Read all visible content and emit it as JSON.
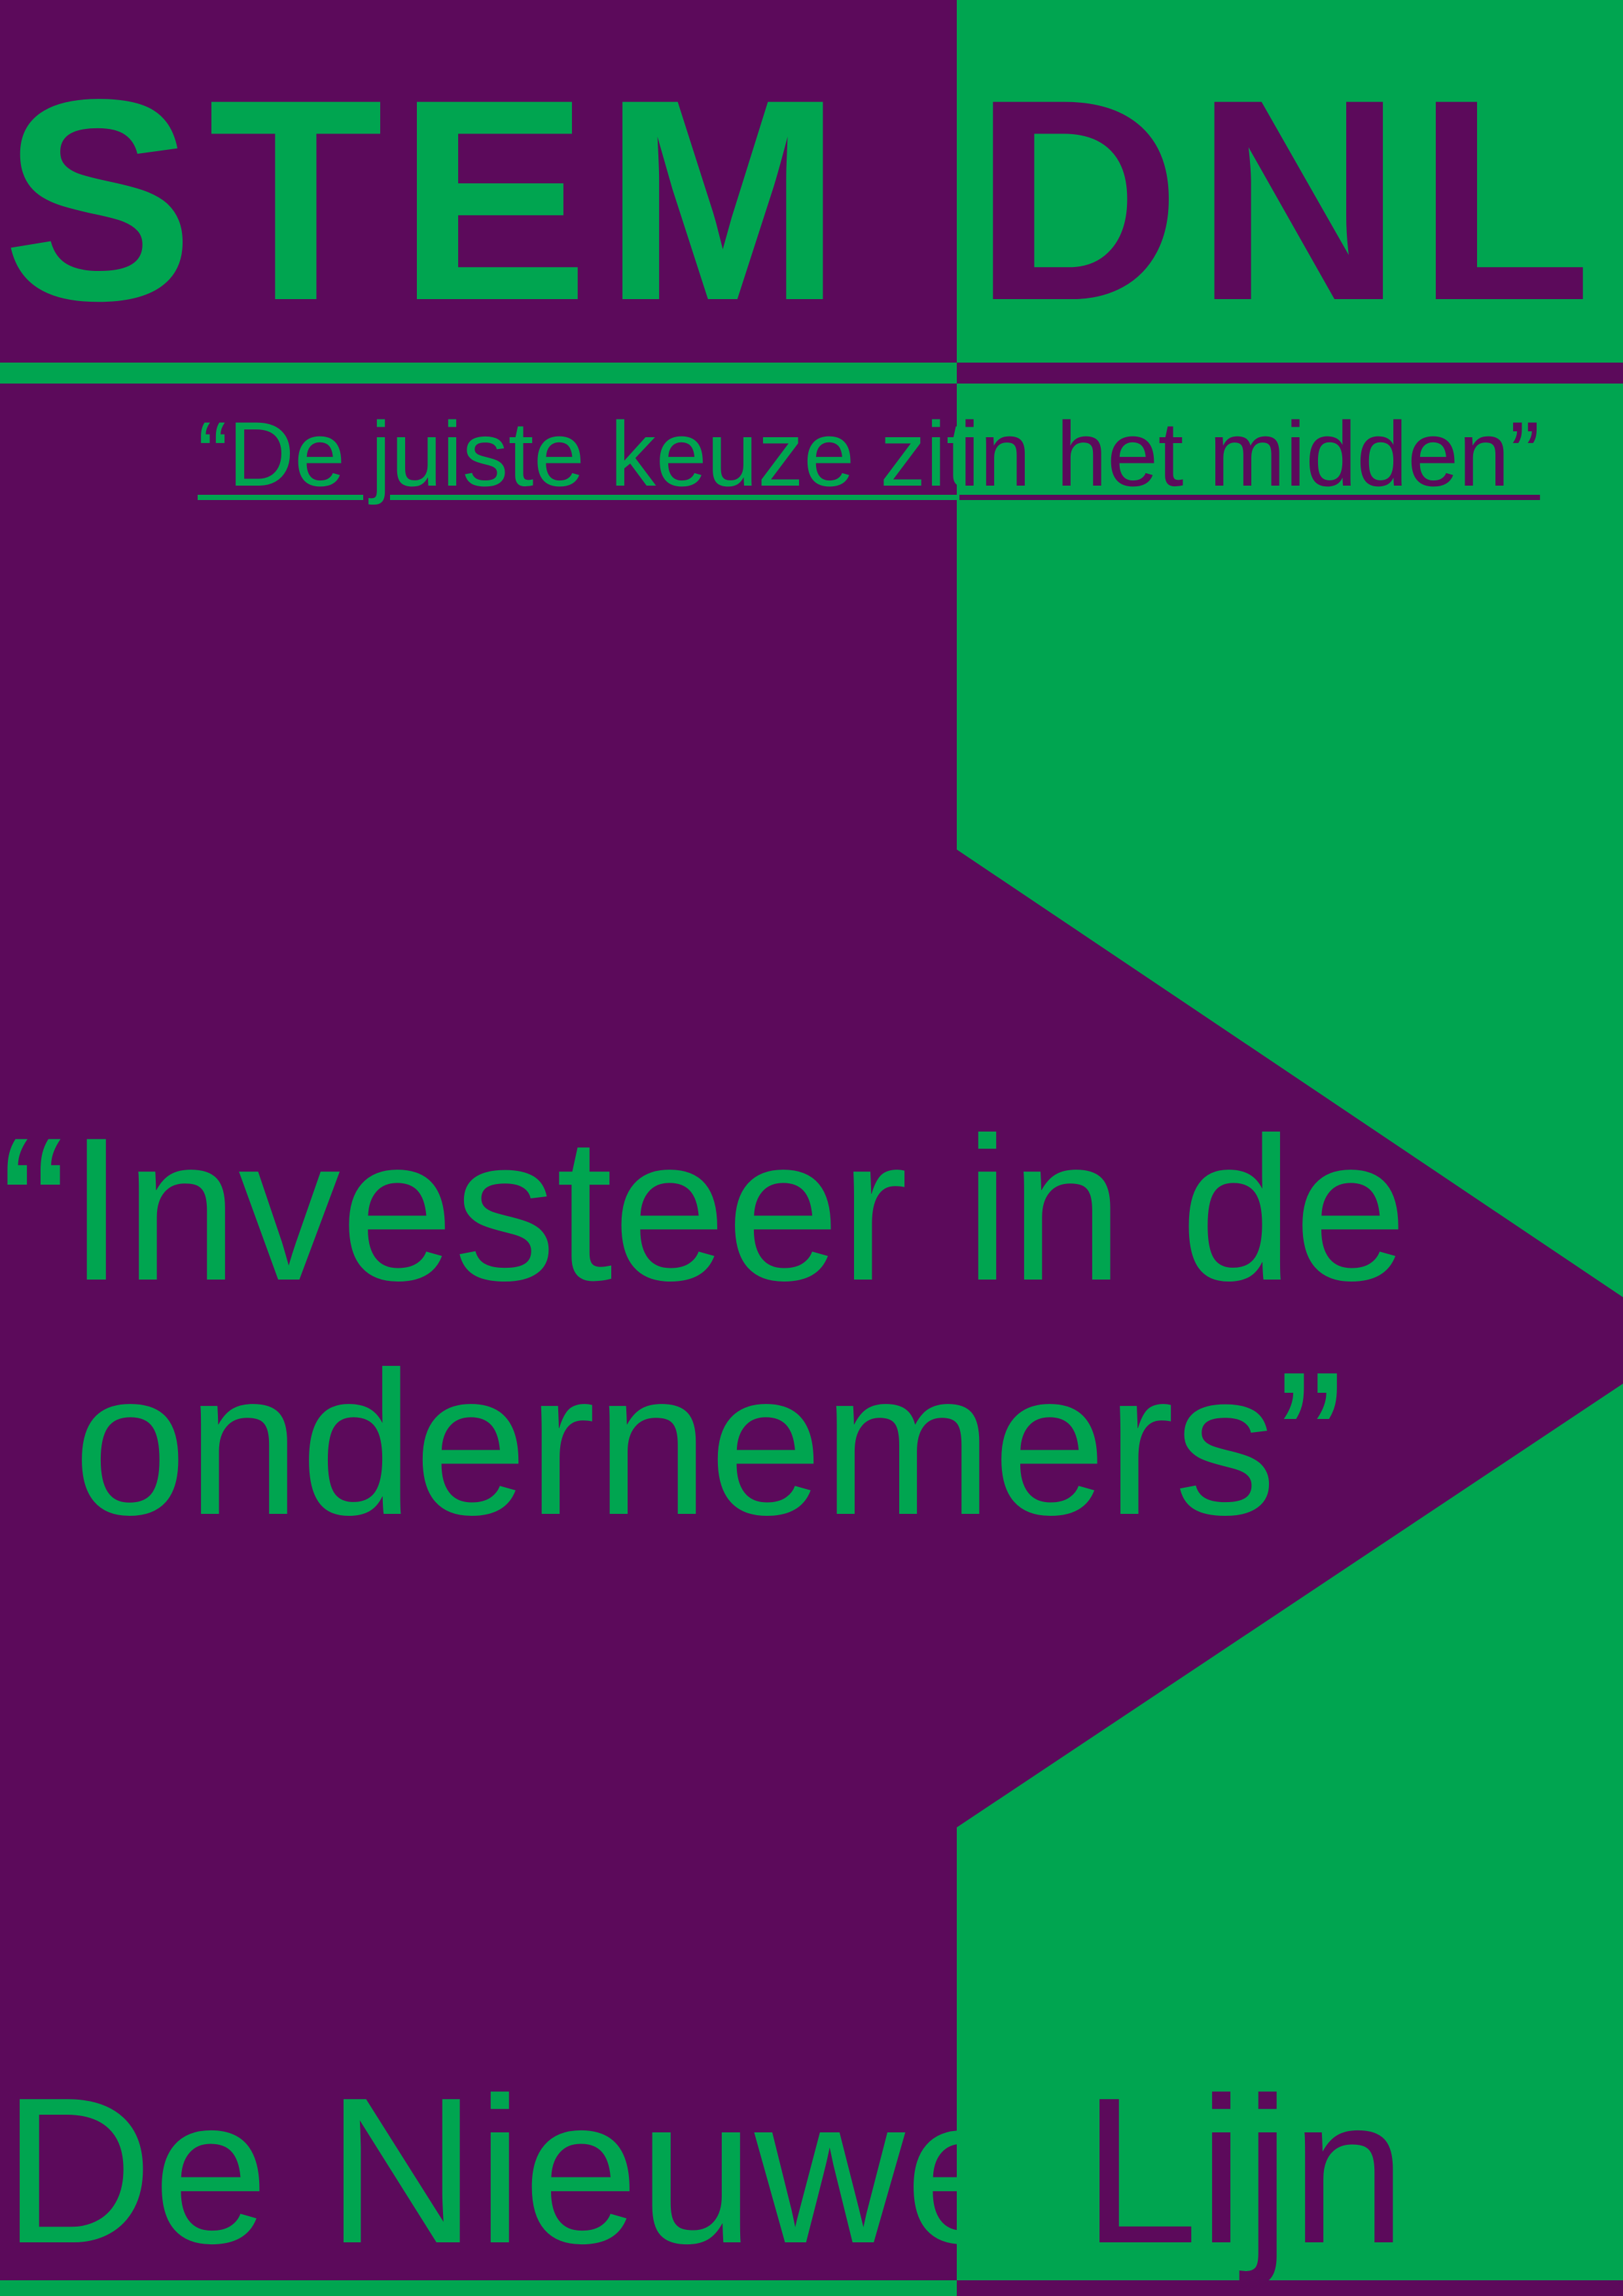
{
  "colors": {
    "purple": "#5c0a5b",
    "green": "#00a550"
  },
  "header": {
    "left": "STEM",
    "right": "DNL"
  },
  "slogan": {
    "left": "“De juiste keuze zit",
    "right": "in het midden”"
  },
  "quote": {
    "line1": "“Investeer in de",
    "line2": "ondernemers”"
  },
  "footer": {
    "left": "De Nieuwe",
    "right": "Lijn"
  }
}
